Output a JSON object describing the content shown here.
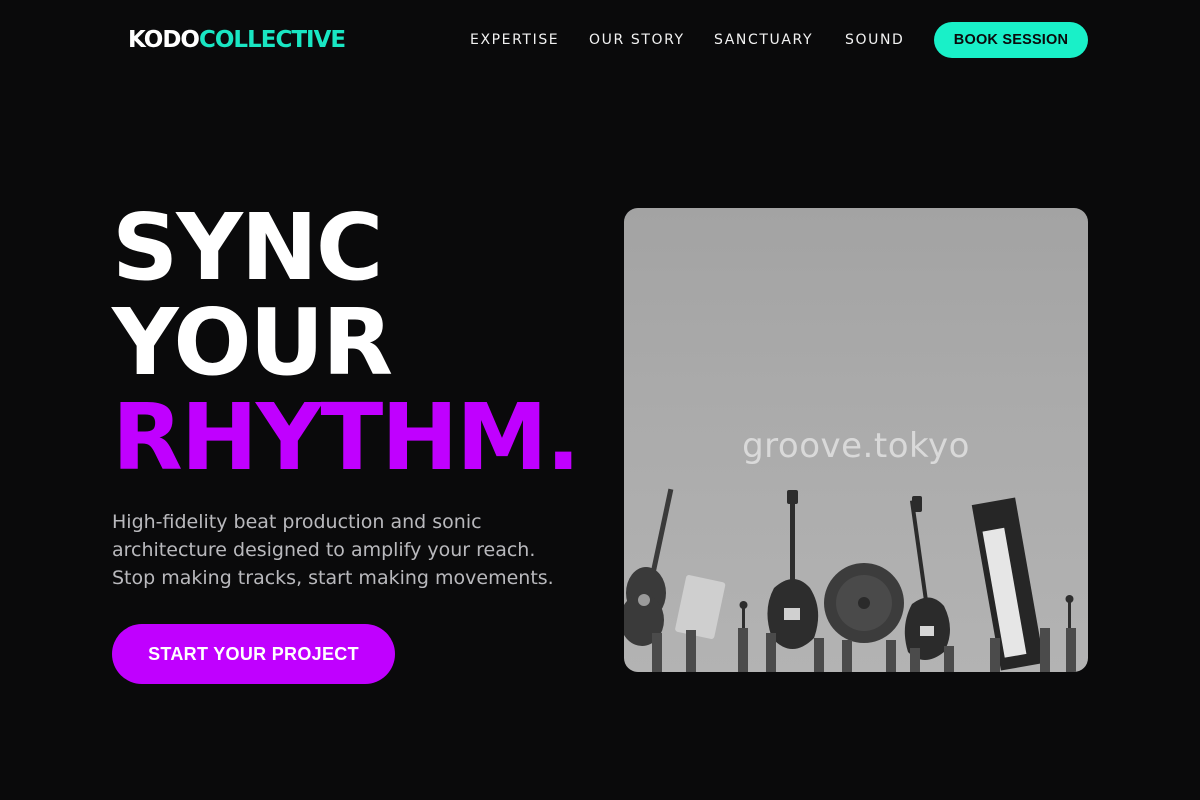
{
  "nav": {
    "logo_part1": "KODO",
    "logo_part2": "COLLECTIVE",
    "links": [
      "EXPERTISE",
      "OUR STORY",
      "SANCTUARY",
      "SOUND"
    ],
    "cta_label": "BOOK SESSION"
  },
  "hero": {
    "title_line1": "SYNC",
    "title_line2": "YOUR",
    "title_line3": "RHYTHM.",
    "subtitle_lines": [
      "High-fidelity beat production and sonic",
      "architecture designed to amplify your reach.",
      "Stop making tracks, start making movements."
    ],
    "cta_label": "START YOUR PROJECT"
  },
  "image": {
    "watermark": "groove.tokyo",
    "subject": "hands-raising-instruments"
  },
  "colors": {
    "background": "#0a0a0b",
    "accent_teal": "#19f0c8",
    "accent_purple": "#c000ff",
    "text_muted": "#b9b9bd"
  }
}
